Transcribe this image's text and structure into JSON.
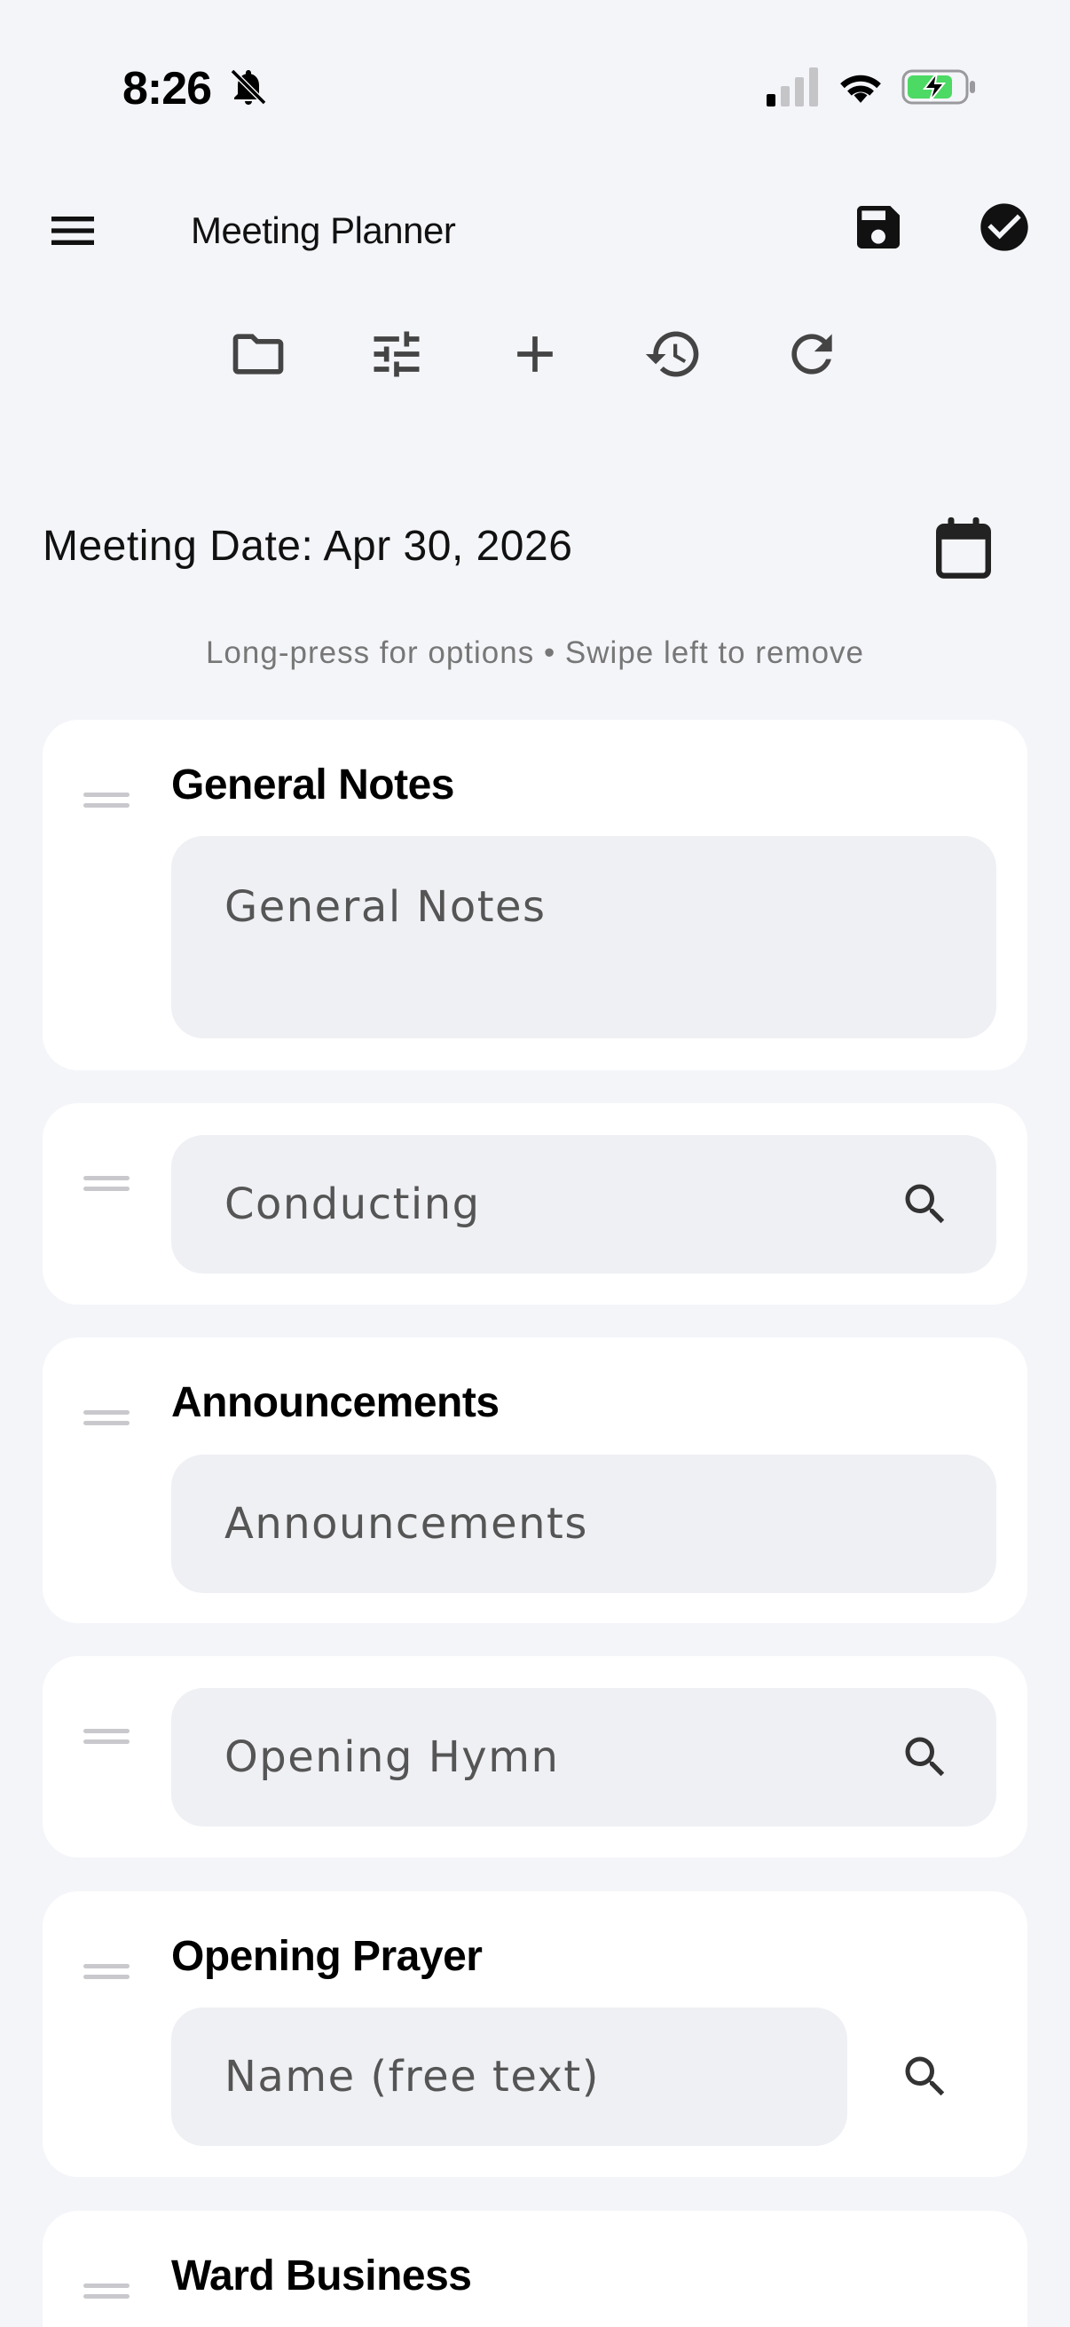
{
  "status_bar": {
    "time": "8:26",
    "icons": [
      "bell-off-icon",
      "signal-icon",
      "wifi-icon",
      "battery-charging-icon"
    ]
  },
  "app_bar": {
    "title": "Meeting Planner",
    "icons": [
      "menu-icon",
      "save-icon",
      "check-circle-icon"
    ]
  },
  "toolbar": {
    "icons": [
      "folder-icon",
      "tune-icon",
      "plus-icon",
      "history-icon",
      "refresh-icon"
    ]
  },
  "meeting": {
    "date_label": "Meeting Date: Apr 30, 2026",
    "hint": "Long-press for options • Swipe left to remove"
  },
  "cards": {
    "general_notes": {
      "title": "General Notes",
      "placeholder": "General Notes"
    },
    "conducting": {
      "placeholder": "Conducting"
    },
    "announcements": {
      "title": "Announcements",
      "placeholder": "Announcements"
    },
    "opening_hymn": {
      "placeholder": "Opening Hymn"
    },
    "opening_prayer": {
      "title": "Opening Prayer",
      "placeholder": "Name (free text)"
    },
    "ward_business": {
      "title": "Ward Business"
    }
  },
  "colors": {
    "background": "#f4f5f9",
    "card": "#ffffff",
    "field": "#eff0f4",
    "battery_green": "#4cd964"
  }
}
